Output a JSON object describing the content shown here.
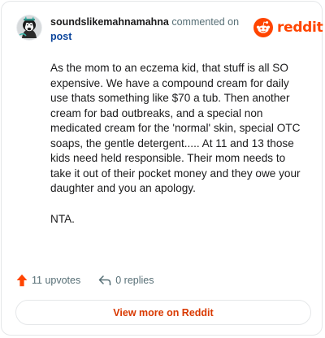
{
  "comment": {
    "username": "soundslikemahnamahna",
    "action_text": " commented on",
    "post_link": "post",
    "paragraphs": [
      "As the mom to an eczema kid, that stuff is all SO expensive. We have a compound cream for daily use thats something like $70 a tub. Then another cream for bad outbreaks, and a special non medicated cream for the 'normal' skin, special OTC soaps, the gentle detergent..... At 11 and 13 those kids need held responsible. Their mom needs to take it out of their pocket money and they owe your daughter and you an apology.",
      "NTA."
    ]
  },
  "brand": {
    "wordmark": "reddit",
    "logo_icon": "reddit-snoo-icon",
    "color": "#ff4500"
  },
  "stats": {
    "upvotes_label": "11 upvotes",
    "upvote_icon": "upvote-arrow-icon",
    "upvote_color": "#ff4500",
    "replies_label": "0 replies",
    "reply_icon": "reply-arrow-icon"
  },
  "cta": {
    "label": "View more on Reddit",
    "color": "#d93900"
  }
}
